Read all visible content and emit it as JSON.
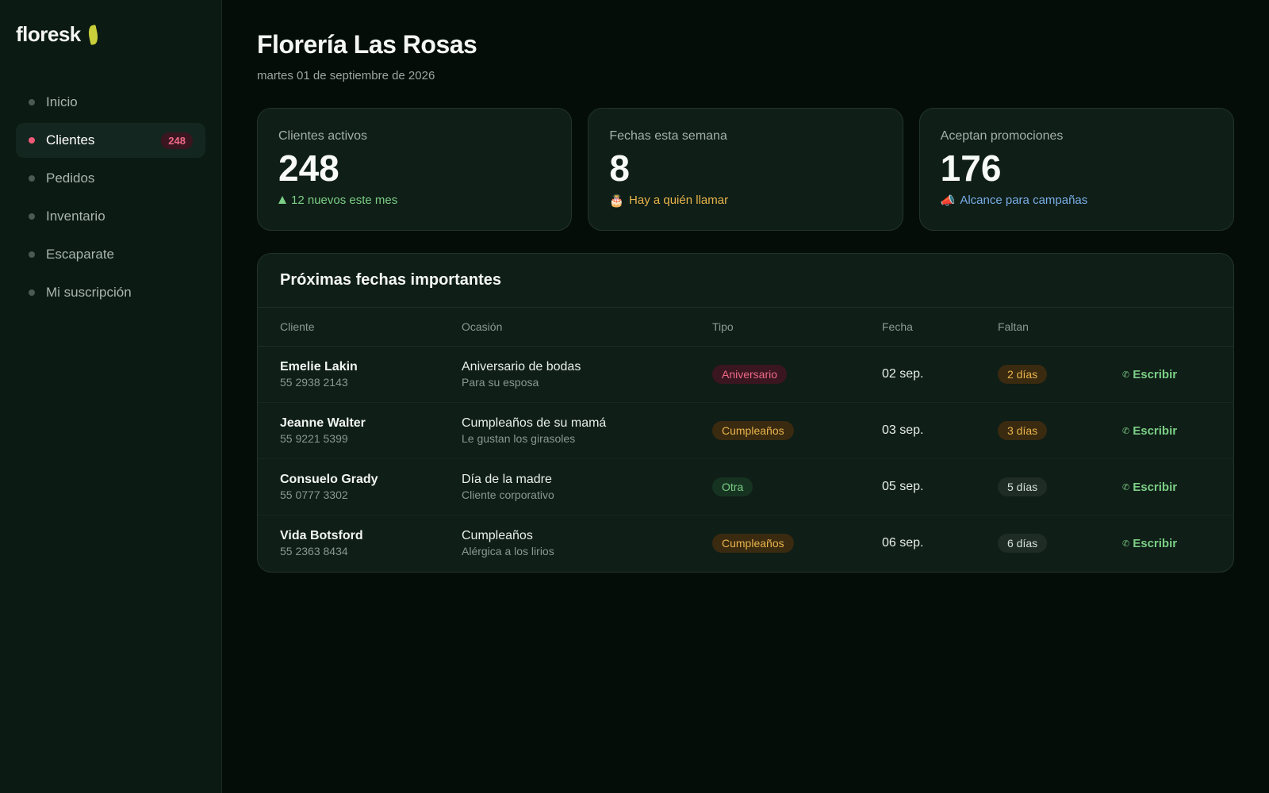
{
  "sidebar": {
    "logo": "floresk",
    "items": [
      {
        "label": "Inicio"
      },
      {
        "label": "Clientes",
        "badge": "248"
      },
      {
        "label": "Pedidos"
      },
      {
        "label": "Inventario"
      },
      {
        "label": "Escaparate"
      },
      {
        "label": "Mi suscripción"
      }
    ],
    "active_index": 1
  },
  "header": {
    "title": "Florería Las Rosas",
    "date": "martes 01 de septiembre de 2026"
  },
  "stats": [
    {
      "label": "Clientes activos",
      "value": "248",
      "note": "12 nuevos este mes",
      "icon": "trend-up-icon"
    },
    {
      "label": "Fechas esta semana",
      "value": "8",
      "note": "Hay a quién llamar",
      "icon": "cake-icon",
      "icon_glyph": "🎂"
    },
    {
      "label": "Aceptan promociones",
      "value": "176",
      "note": "Alcance para campañas",
      "icon": "megaphone-icon",
      "icon_glyph": "📣"
    }
  ],
  "upcoming": {
    "title": "Próximas fechas importantes",
    "columns": [
      "Cliente",
      "Ocasión",
      "Tipo",
      "Fecha",
      "Faltan",
      ""
    ],
    "action_label": "Escribir",
    "action_icon": "phone-icon",
    "rows": [
      {
        "name": "Emelie Lakin",
        "phone": "55 2938 2143",
        "occasion": "Aniversario de bodas",
        "note": "Para su esposa",
        "type": "Aniversario",
        "date": "02 sep.",
        "remaining": "2 días"
      },
      {
        "name": "Jeanne Walter",
        "phone": "55 9221 5399",
        "occasion": "Cumpleaños de su mamá",
        "note": "Le gustan los girasoles",
        "type": "Cumpleaños",
        "date": "03 sep.",
        "remaining": "3 días"
      },
      {
        "name": "Consuelo Grady",
        "phone": "55 0777 3302",
        "occasion": "Día de la madre",
        "note": "Cliente corporativo",
        "type": "Otra",
        "date": "05 sep.",
        "remaining": "5 días"
      },
      {
        "name": "Vida Botsford",
        "phone": "55 2363 8434",
        "occasion": "Cumpleaños",
        "note": "Alérgica a los lirios",
        "type": "Cumpleaños",
        "date": "06 sep.",
        "remaining": "6 días"
      }
    ]
  },
  "colors": {
    "accent_green": "#7ccf86",
    "accent_pink": "#ee6a86",
    "accent_amber": "#e9b44c",
    "accent_blue": "#7aaee8",
    "leaf": "#c9cf3a"
  }
}
